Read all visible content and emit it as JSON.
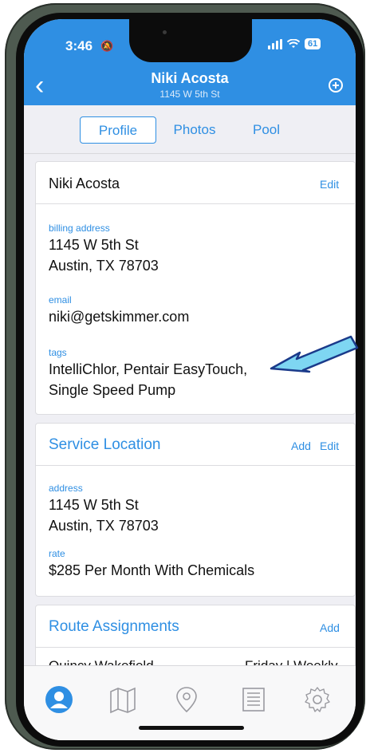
{
  "status_bar": {
    "time": "3:46",
    "battery": "61"
  },
  "nav": {
    "title": "Niki Acosta",
    "subtitle": "1145 W 5th St"
  },
  "tabs": [
    {
      "label": "Profile",
      "active": true
    },
    {
      "label": "Photos",
      "active": false
    },
    {
      "label": "Pool",
      "active": false
    }
  ],
  "profile_card": {
    "name": "Niki Acosta",
    "edit_label": "Edit",
    "billing_label": "billing address",
    "billing_line1": "1145 W 5th St",
    "billing_line2": "Austin, TX 78703",
    "email_label": "email",
    "email_value": "niki@getskimmer.com",
    "tags_label": "tags",
    "tags_line1": "IntelliChlor, Pentair EasyTouch,",
    "tags_line2": "Single Speed Pump"
  },
  "service_card": {
    "title": "Service Location",
    "add_label": "Add",
    "edit_label": "Edit",
    "address_label": "address",
    "address_line1": "1145 W 5th St",
    "address_line2": "Austin, TX 78703",
    "rate_label": "rate",
    "rate_value": "$285 Per Month With Chemicals"
  },
  "route_card": {
    "title": "Route Assignments",
    "add_label": "Add",
    "rows": [
      {
        "tech": "Quincy Wakefield",
        "schedule": "Friday | Weekly"
      }
    ]
  },
  "bottom_tabs": [
    {
      "icon": "person-icon",
      "active": true
    },
    {
      "icon": "map-icon",
      "active": false
    },
    {
      "icon": "location-pin-icon",
      "active": false
    },
    {
      "icon": "list-icon",
      "active": false
    },
    {
      "icon": "gear-icon",
      "active": false
    }
  ],
  "colors": {
    "accent": "#2f8fe3",
    "arrow_fill": "#7ed6f2",
    "arrow_stroke": "#1a3a8a"
  }
}
